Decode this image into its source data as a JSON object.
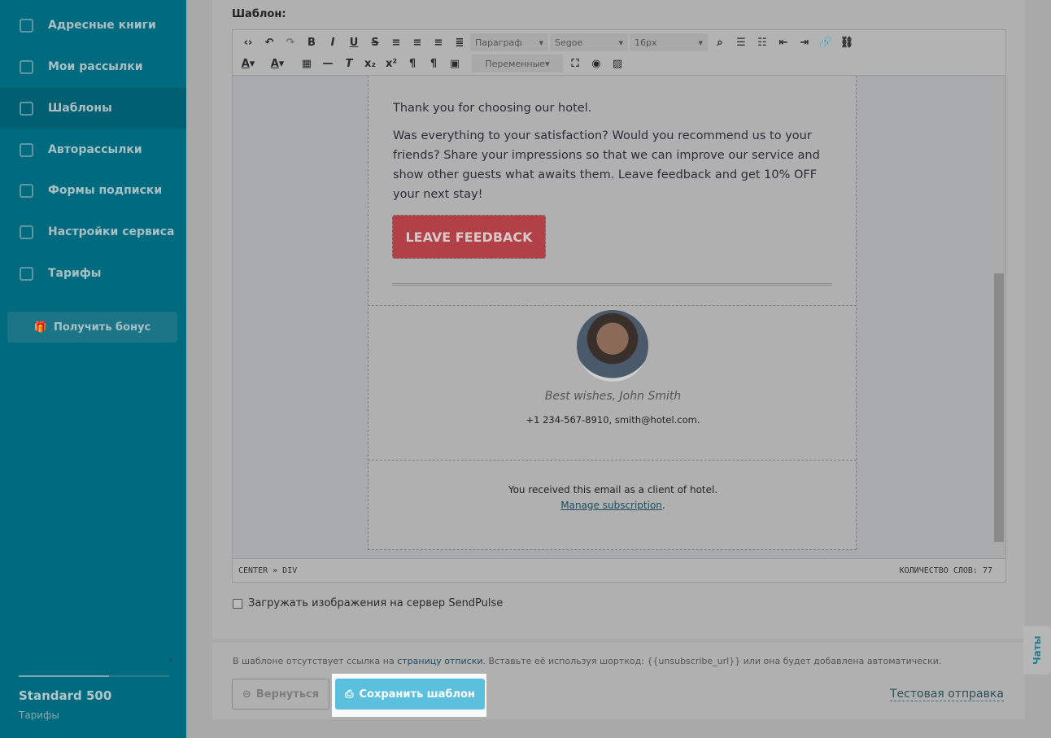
{
  "sidebar": {
    "items": [
      {
        "label": "Адресные книги",
        "icon": "address-book-icon"
      },
      {
        "label": "Мои рассылки",
        "icon": "send-icon"
      },
      {
        "label": "Шаблоны",
        "icon": "template-icon",
        "active": true
      },
      {
        "label": "Авторассылки",
        "icon": "automation-icon"
      },
      {
        "label": "Формы подписки",
        "icon": "form-icon"
      },
      {
        "label": "Настройки сервиса",
        "icon": "settings-icon"
      },
      {
        "label": "Тарифы",
        "icon": "wallet-icon"
      }
    ],
    "bonus": "Получить бонус",
    "plan": "Standard 500",
    "plan_link": "Тарифы",
    "plan_progress": 0.6
  },
  "editor": {
    "label": "Шаблон:",
    "toolbar": {
      "format": "Параграф",
      "font": "Segoe",
      "size": "16px",
      "variables": "Переменные"
    },
    "email": {
      "p1": "Thank you for choosing our hotel.",
      "p2": "Was everything to your satisfaction? Would you recommend us to your friends? Share your impressions so that we can improve our service and show other guests what awaits them. Leave feedback and get 10% OFF your next stay!",
      "button": "LEAVE FEEDBACK",
      "signature": "Best wishes, John Smith",
      "contacts": "+1 234-567-8910, smith@hotel.com.",
      "footer": "You received this email as a client of hotel.",
      "manage": "Manage subscription",
      "manage_suffix": "."
    },
    "path": "CENTER » DIV",
    "word_count": "КОЛИЧЕСТВО СЛОВ: 77"
  },
  "upload_checkbox": {
    "label": "Загружать изображения на сервер SendPulse",
    "checked": false
  },
  "footer": {
    "note_pre": "В шаблоне отсутствует ссылка на ",
    "note_link": "страницу отписки",
    "note_post": ". Вставьте её используя шорткод: {{unsubscribe_url}} или она будет добавлена автоматически.",
    "back": "Вернуться",
    "save": "Сохранить шаблон",
    "test": "Тестовая отправка"
  },
  "chats": "Чаты",
  "colors": {
    "sidebar": "#006a7e",
    "save": "#5bc0de",
    "button": "#b24147"
  }
}
